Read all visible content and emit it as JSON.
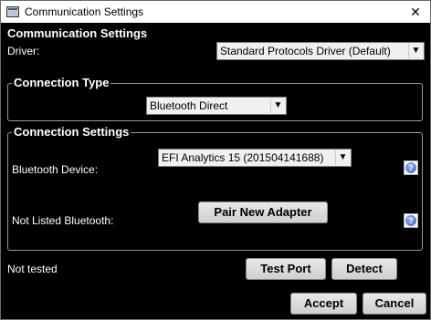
{
  "window": {
    "title": "Communication Settings",
    "close_glyph": "✕"
  },
  "main": {
    "heading": "Communication Settings",
    "driver_label": "Driver:",
    "driver_value": "Standard Protocols Driver (Default)"
  },
  "connection_type": {
    "group_title": "Connection Type",
    "selected": "Bluetooth Direct"
  },
  "connection_settings": {
    "group_title": "Connection Settings",
    "bluetooth_device_label": "Bluetooth Device:",
    "bluetooth_device_value": "EFI Analytics 15 (201504141688)",
    "not_listed_label": "Not Listed Bluetooth:",
    "pair_button": "Pair New Adapter",
    "help_glyph": "?"
  },
  "status": {
    "text": "Not tested"
  },
  "buttons": {
    "test_port": "Test Port",
    "detect": "Detect",
    "accept": "Accept",
    "cancel": "Cancel"
  },
  "icons": {
    "app": "app-window-icon",
    "help": "help-icon",
    "dropdown": "chevron-down-icon",
    "close": "close-icon"
  }
}
